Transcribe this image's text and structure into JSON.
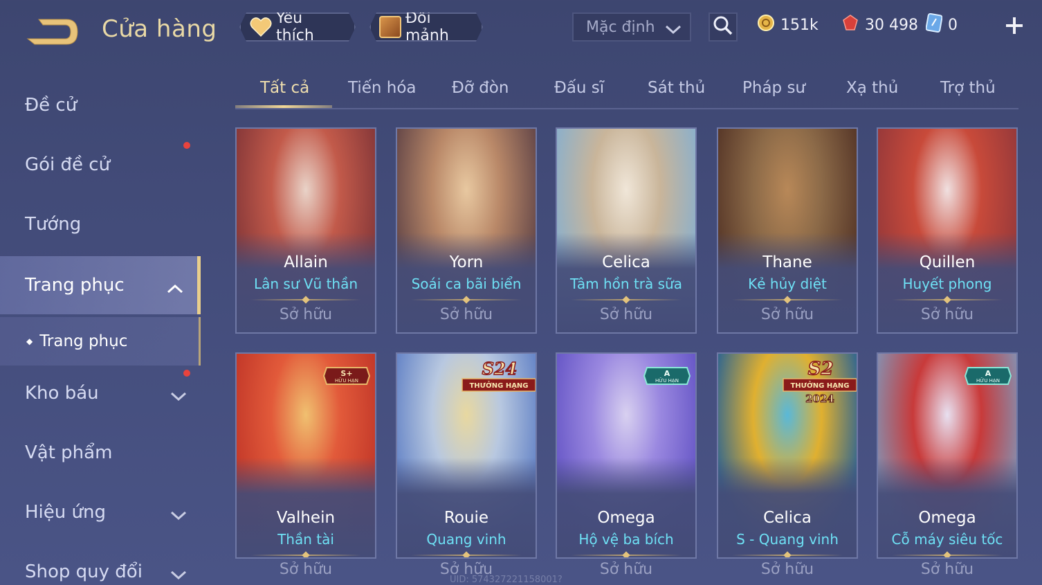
{
  "header": {
    "title": "Cửa hàng",
    "favorite_label": "Yêu thích",
    "shard_label": "Đổi mảnh",
    "sort_value": "Mặc định",
    "currencies": {
      "gold": "151k",
      "ruby": "30 498",
      "crystal": "0"
    }
  },
  "sidebar": {
    "items": [
      {
        "label": "Đề cử"
      },
      {
        "label": "Gói đề cử"
      },
      {
        "label": "Tướng"
      },
      {
        "label": "Trang phục"
      },
      {
        "label": "Trang phục"
      },
      {
        "label": "Kho báu"
      },
      {
        "label": "Vật phẩm"
      },
      {
        "label": "Hiệu ứng"
      },
      {
        "label": "Shop quy đổi"
      }
    ]
  },
  "tabs": [
    {
      "label": "Tất cả"
    },
    {
      "label": "Tiến hóa"
    },
    {
      "label": "Đỡ đòn"
    },
    {
      "label": "Đấu sĩ"
    },
    {
      "label": "Sát thủ"
    },
    {
      "label": "Pháp sư"
    },
    {
      "label": "Xạ thủ"
    },
    {
      "label": "Trợ thủ"
    }
  ],
  "cards": [
    {
      "hero": "Allain",
      "skin": "Lân sư Vũ thần",
      "status": "Sở hữu",
      "colors": [
        "#8a3a3a",
        "#c25a4a",
        "#e9d3c8"
      ]
    },
    {
      "hero": "Yorn",
      "skin": "Soái ca bãi biển",
      "status": "Sở hữu",
      "colors": [
        "#6a4b4a",
        "#b98868",
        "#e8c8a0"
      ]
    },
    {
      "hero": "Celica",
      "skin": "Tâm hồn trà sữa",
      "status": "Sở hữu",
      "colors": [
        "#8fb0c8",
        "#c9b59a",
        "#f0e6d8"
      ]
    },
    {
      "hero": "Thane",
      "skin": "Kẻ hủy diệt",
      "status": "Sở hữu",
      "colors": [
        "#5a3a2a",
        "#8c6a48",
        "#b88858"
      ]
    },
    {
      "hero": "Quillen",
      "skin": "Huyết phong",
      "status": "Sở hữu",
      "colors": [
        "#9a3a3a",
        "#c84a3a",
        "#f0e0e0"
      ]
    },
    {
      "hero": "Valhein",
      "skin": "Thần tài",
      "status": "Sở hữu",
      "colors": [
        "#c43a2a",
        "#e25a3a",
        "#f0c070"
      ]
    },
    {
      "hero": "Rouie",
      "skin": "Quang vinh",
      "status": "Sở hữu",
      "colors": [
        "#6a88c8",
        "#b8c8e0",
        "#e8d8a0"
      ]
    },
    {
      "hero": "Omega",
      "skin": "Hộ vệ ba bích",
      "status": "Sở hữu",
      "colors": [
        "#6a5ac8",
        "#9a88e0",
        "#d8d0f0"
      ]
    },
    {
      "hero": "Celica",
      "skin": "S - Quang vinh",
      "status": "Sở hữu",
      "colors": [
        "#3a6a8a",
        "#e0b030",
        "#5ab8d8"
      ]
    },
    {
      "hero": "Omega",
      "skin": "Cỗ máy siêu tốc",
      "status": "Sở hữu",
      "colors": [
        "#8a8aa8",
        "#c83a3a",
        "#e8e0f0"
      ]
    }
  ],
  "badges": {
    "valhein": {
      "top": "S+",
      "bottom": "HỮU HẠN"
    },
    "rouie": {
      "top": "S24",
      "bottom": "THƯỞNG HẠNG"
    },
    "omega": {
      "top": "A",
      "bottom": "HỮU HẠN"
    },
    "celica": {
      "top": "S2",
      "bottom": "THƯỞNG HẠNG",
      "year": "2024"
    },
    "omega2": {
      "top": "A",
      "bottom": "HỮU HẠN"
    }
  },
  "uid": "UID: 574327221158001?",
  "colors": {
    "accent_gold": "#e9cf8c",
    "skin_name_cyan": "#6ee0f4",
    "background": "#434c7a",
    "red_dot": "#e8433d"
  }
}
